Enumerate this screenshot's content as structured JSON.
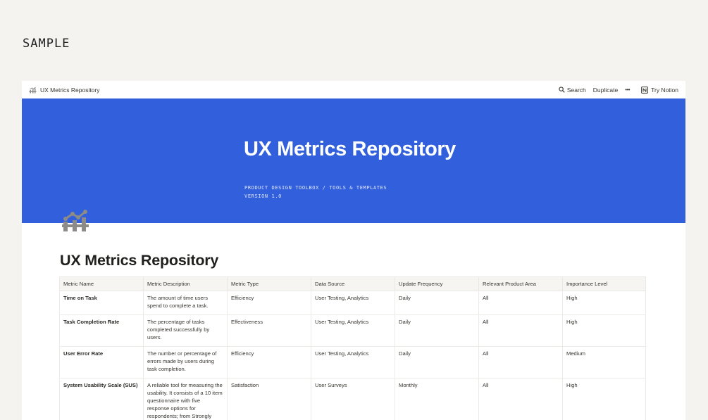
{
  "sample_label": "SAMPLE",
  "topbar": {
    "breadcrumb": "UX Metrics Repository",
    "search_label": "Search",
    "duplicate_label": "Duplicate",
    "more_label": "•••",
    "try_notion_label": "Try Notion"
  },
  "cover": {
    "title": "UX Metrics Repository",
    "subtitle_line1": "PRODUCT DESIGN TOOLBOX / TOOLS & TEMPLATES",
    "subtitle_line2": "VERSION 1.0",
    "color": "#3260dc"
  },
  "page": {
    "icon": "chart-icon",
    "title": "UX Metrics Repository"
  },
  "table": {
    "columns": [
      "Metric Name",
      "Metric Description",
      "Metric Type",
      "Data Source",
      "Update Frequency",
      "Relevant Product Area",
      "Importance Level"
    ],
    "rows": [
      [
        "Time on Task",
        "The amount of time users spend to complete a task.",
        "Efficiency",
        "User Testing, Analytics",
        "Daily",
        "All",
        "High"
      ],
      [
        "Task Completion Rate",
        "The percentage of tasks completed successfully by users.",
        "Effectiveness",
        "User Testing, Analytics",
        "Daily",
        "All",
        "High"
      ],
      [
        "User Error Rate",
        "The number or percentage of errors made by users during task completion.",
        "Efficiency",
        "User Testing, Analytics",
        "Daily",
        "All",
        "Medium"
      ],
      [
        "System Usability Scale (SUS)",
        "A reliable tool for measuring the usability. It consists of a 10 item questionnaire with five response options for respondents; from Strongly agree to Strongly disagree.",
        "Satisfaction",
        "User Surveys",
        "Monthly",
        "All",
        "High"
      ]
    ]
  }
}
